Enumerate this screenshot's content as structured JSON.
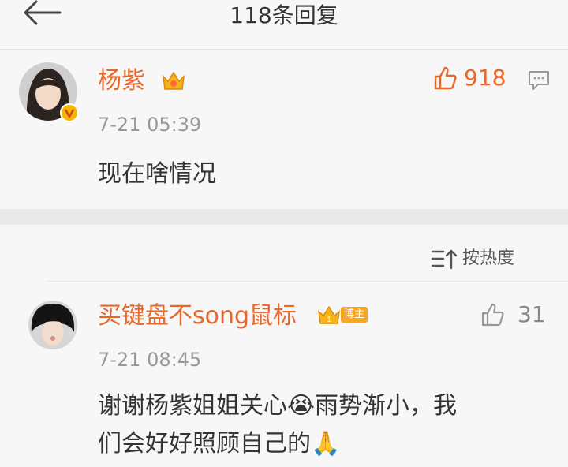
{
  "header": {
    "title": "118条回复"
  },
  "main_comment": {
    "author": "杨紫",
    "time": "7-21 05:39",
    "text": "现在啥情况",
    "likes": "918"
  },
  "sort": {
    "label": "按热度"
  },
  "replies": [
    {
      "author": "买键盘不song鼠标",
      "badge": "博主",
      "time": "7-21 08:45",
      "text_line1": "谢谢杨紫姐姐关心😭雨势渐小，我",
      "text_line2": "们会好好照顾自己的🙏",
      "likes": "31"
    }
  ],
  "colors": {
    "accent": "#e8672a",
    "meta": "#999999",
    "background": "#f7f7f7"
  }
}
